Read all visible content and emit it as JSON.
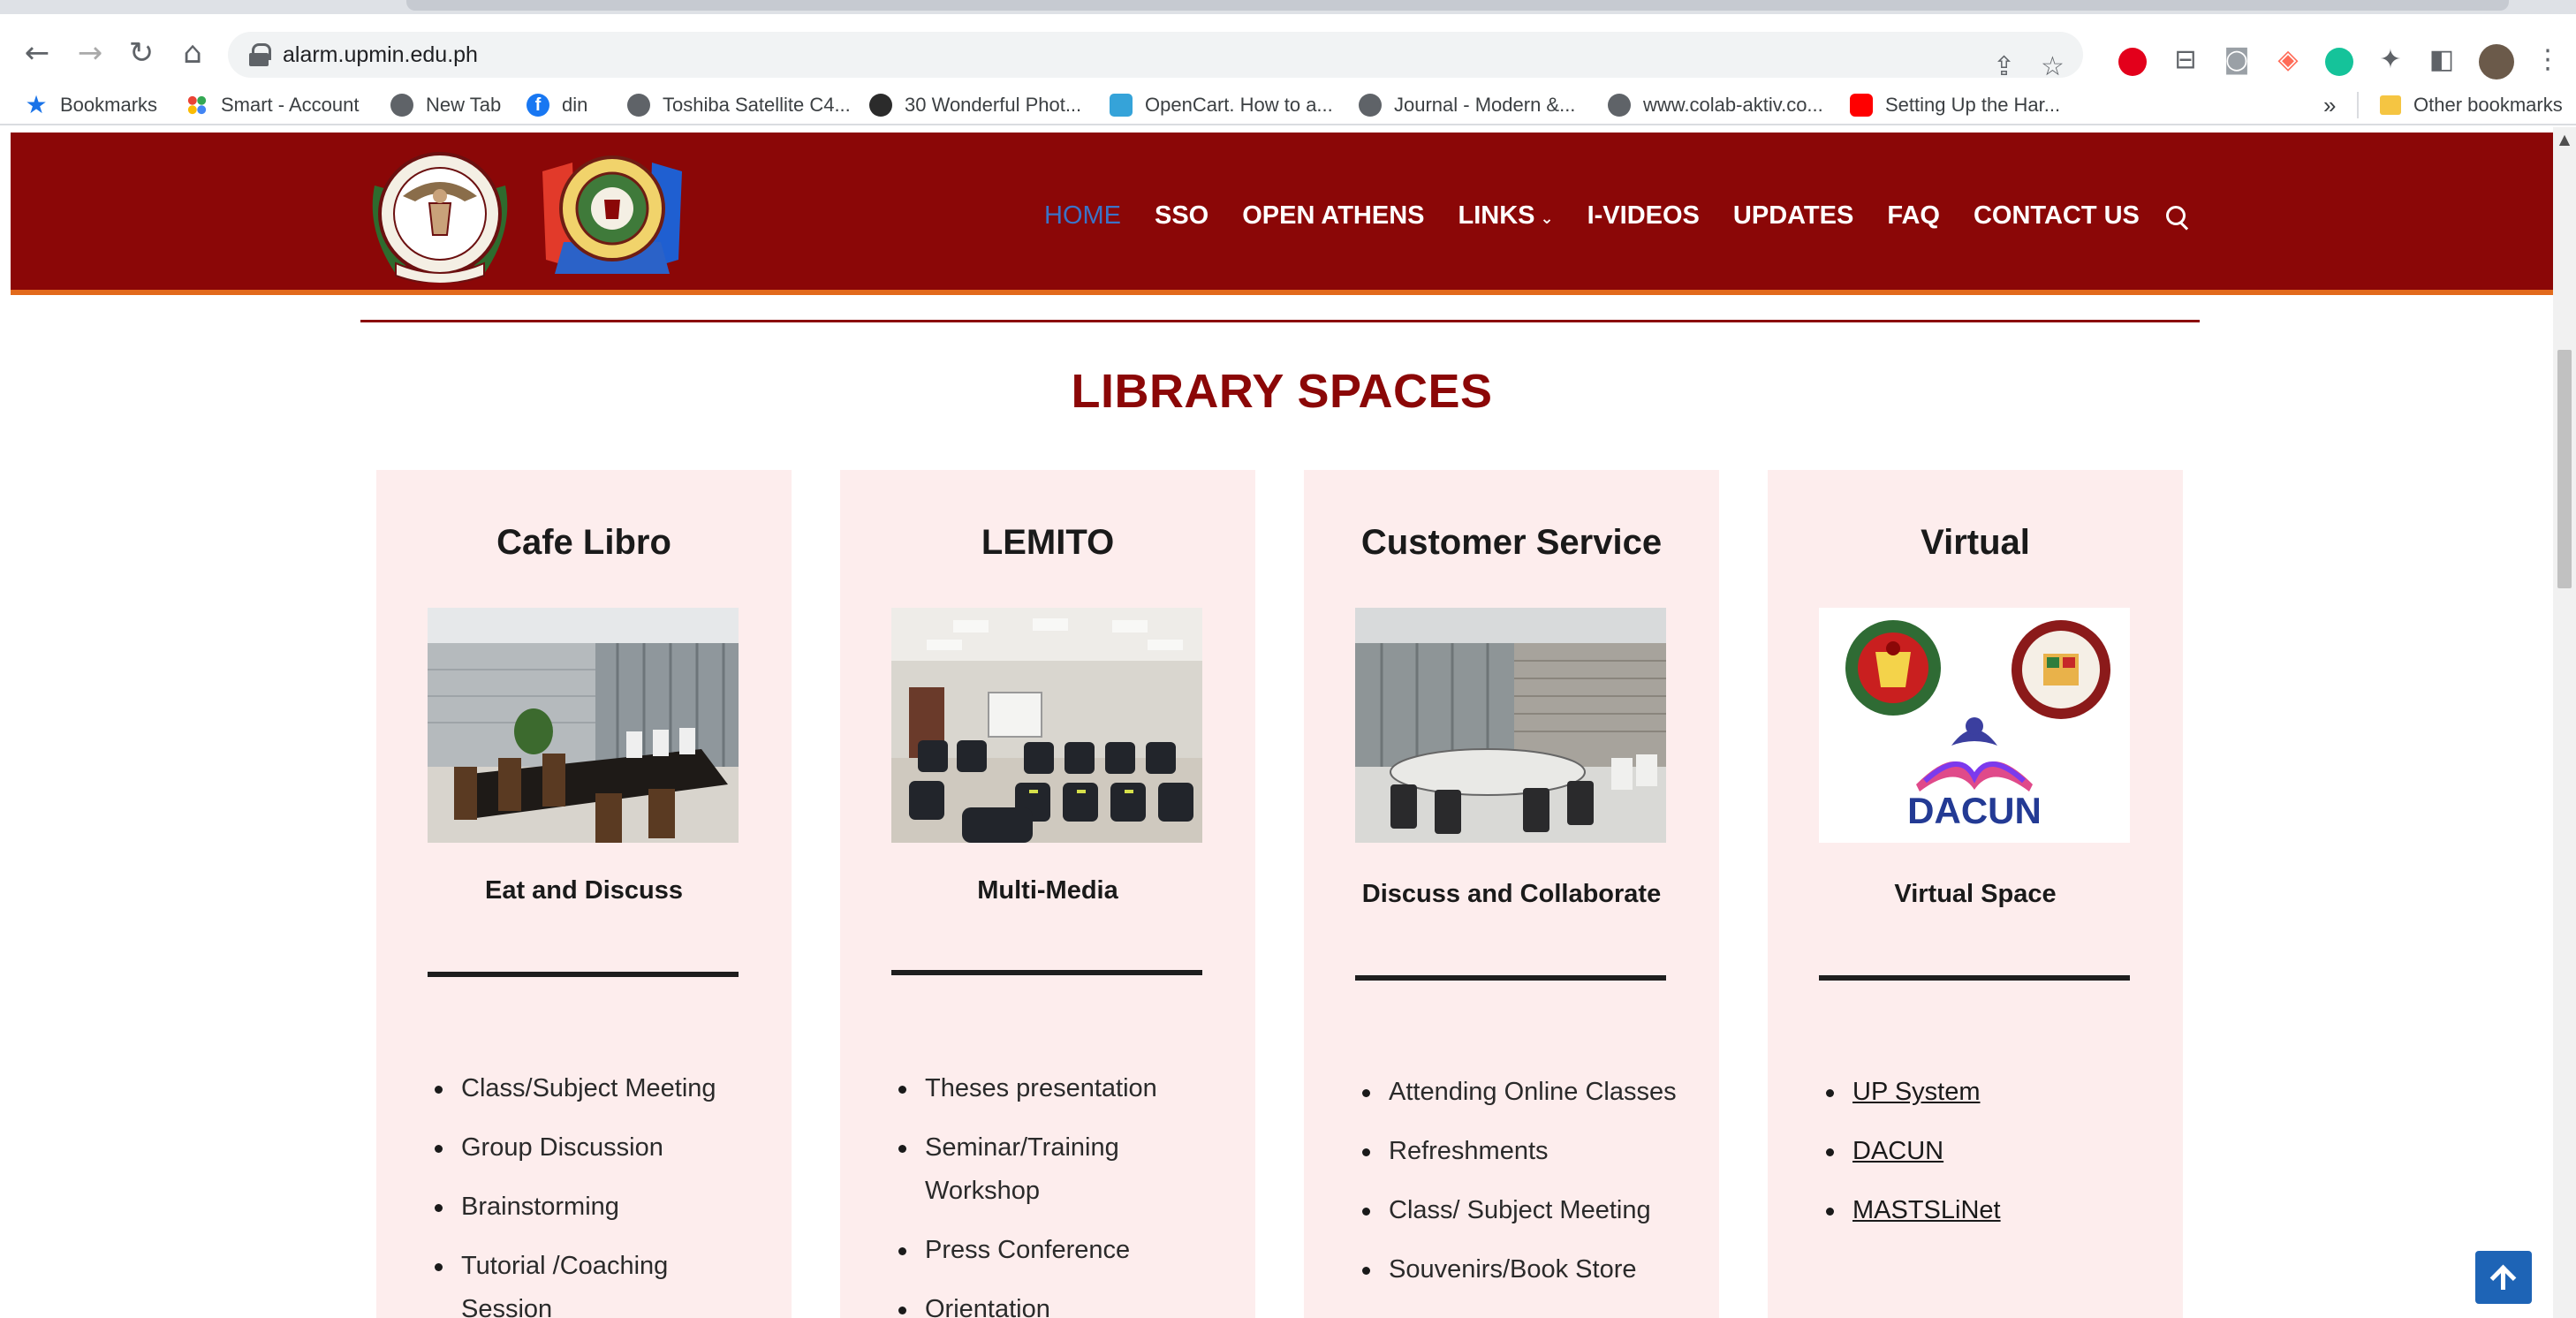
{
  "browser": {
    "url": "alarm.upmin.edu.ph",
    "bookmarks": [
      {
        "label": "Bookmarks",
        "icon": "star-icon"
      },
      {
        "label": "Smart - Account",
        "icon": "dots-icon"
      },
      {
        "label": "New Tab",
        "icon": "globe-icon"
      },
      {
        "label": "din",
        "icon": "facebook-icon"
      },
      {
        "label": "Toshiba Satellite C4...",
        "icon": "globe-icon"
      },
      {
        "label": "30 Wonderful Phot...",
        "icon": "photo-icon"
      },
      {
        "label": "OpenCart. How to a...",
        "icon": "opencart-icon"
      },
      {
        "label": "Journal - Modern &...",
        "icon": "globe-icon"
      },
      {
        "label": "www.colab-aktiv.co...",
        "icon": "globe-icon"
      },
      {
        "label": "Setting Up the Har...",
        "icon": "youtube-icon"
      }
    ],
    "more_bookmarks": "»",
    "other_bookmarks": "Other bookmarks"
  },
  "site": {
    "nav": {
      "home": "HOME",
      "sso": "SSO",
      "open_athens": "OPEN ATHENS",
      "links": "LINKS",
      "links_caret": "⌄",
      "ivideos": "I-VIDEOS",
      "updates": "UPDATES",
      "faq": "FAQ",
      "contact": "CONTACT US"
    },
    "accent_color": "#8b0707",
    "section_title": "LIBRARY SPACES",
    "cards": [
      {
        "title": "Cafe Libro",
        "subtitle": "Eat and Discuss",
        "items": [
          "Class/Subject Meeting",
          "Group Discussion",
          "Brainstorming",
          "Tutorial /Coaching Session"
        ]
      },
      {
        "title": "LEMITO",
        "subtitle": "Multi-Media",
        "items": [
          "Theses presentation",
          "Seminar/Training Workshop",
          "Press Conference",
          "Orientation"
        ]
      },
      {
        "title": "Customer Service",
        "subtitle": "Discuss and Collaborate",
        "items": [
          "Attending Online Classes",
          "Refreshments",
          "Class/ Subject Meeting",
          "Souvenirs/Book Store"
        ]
      },
      {
        "title": "Virtual",
        "subtitle": "Virtual Space",
        "items": [
          "UP System",
          "DACUN",
          "MASTSLiNet"
        ],
        "logo_text": "DACUN"
      }
    ]
  }
}
